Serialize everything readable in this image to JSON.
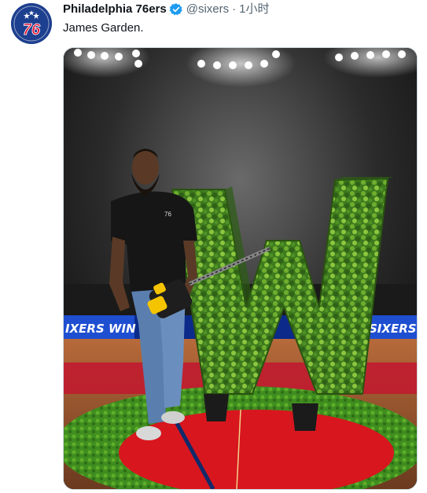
{
  "tweet": {
    "display_name": "Philadelphia 76ers",
    "handle": "@sixers",
    "separator": "·",
    "time": "1小时",
    "text": "James Garden.",
    "avatar_text": "76"
  },
  "image": {
    "banner_left": "IXERS WIN",
    "banner_right": "SIXERS W",
    "jersey_number": "76"
  },
  "colors": {
    "brand_blue": "#1d3f8f",
    "brand_red": "#e01234",
    "verified_blue": "#1d9bf0",
    "muted": "#536471"
  }
}
